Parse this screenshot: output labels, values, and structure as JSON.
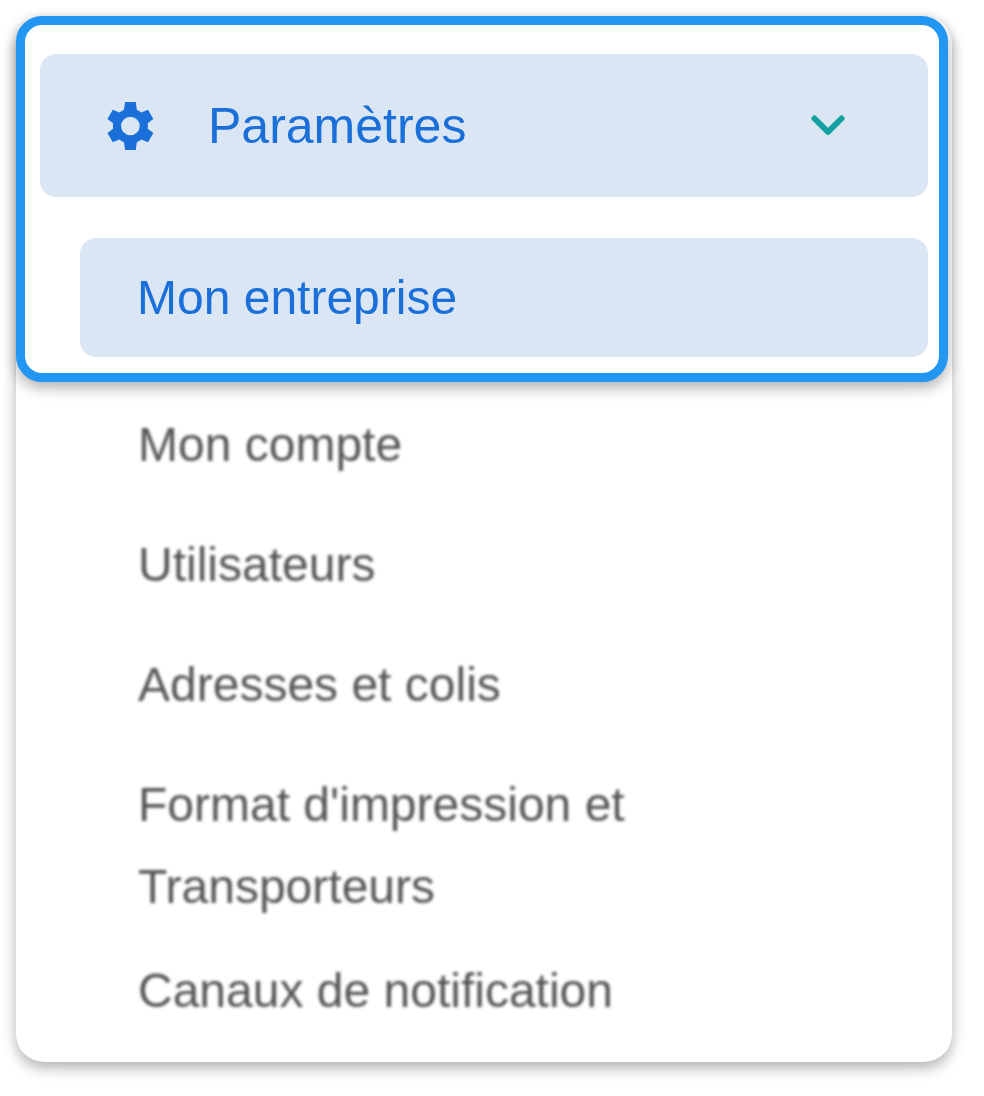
{
  "menu": {
    "label": "Paramètres",
    "expanded": true
  },
  "highlighted_items": [
    {
      "label": "Mon entreprise",
      "selected": true
    }
  ],
  "items": [
    {
      "label": "Mon compte",
      "selected": false
    },
    {
      "label": "Utilisateurs",
      "selected": false
    },
    {
      "label": "Adresses et colis",
      "selected": false
    },
    {
      "label": "Format d'impression et Transporteurs",
      "selected": false
    },
    {
      "label": "Canaux de notification",
      "selected": false
    }
  ]
}
